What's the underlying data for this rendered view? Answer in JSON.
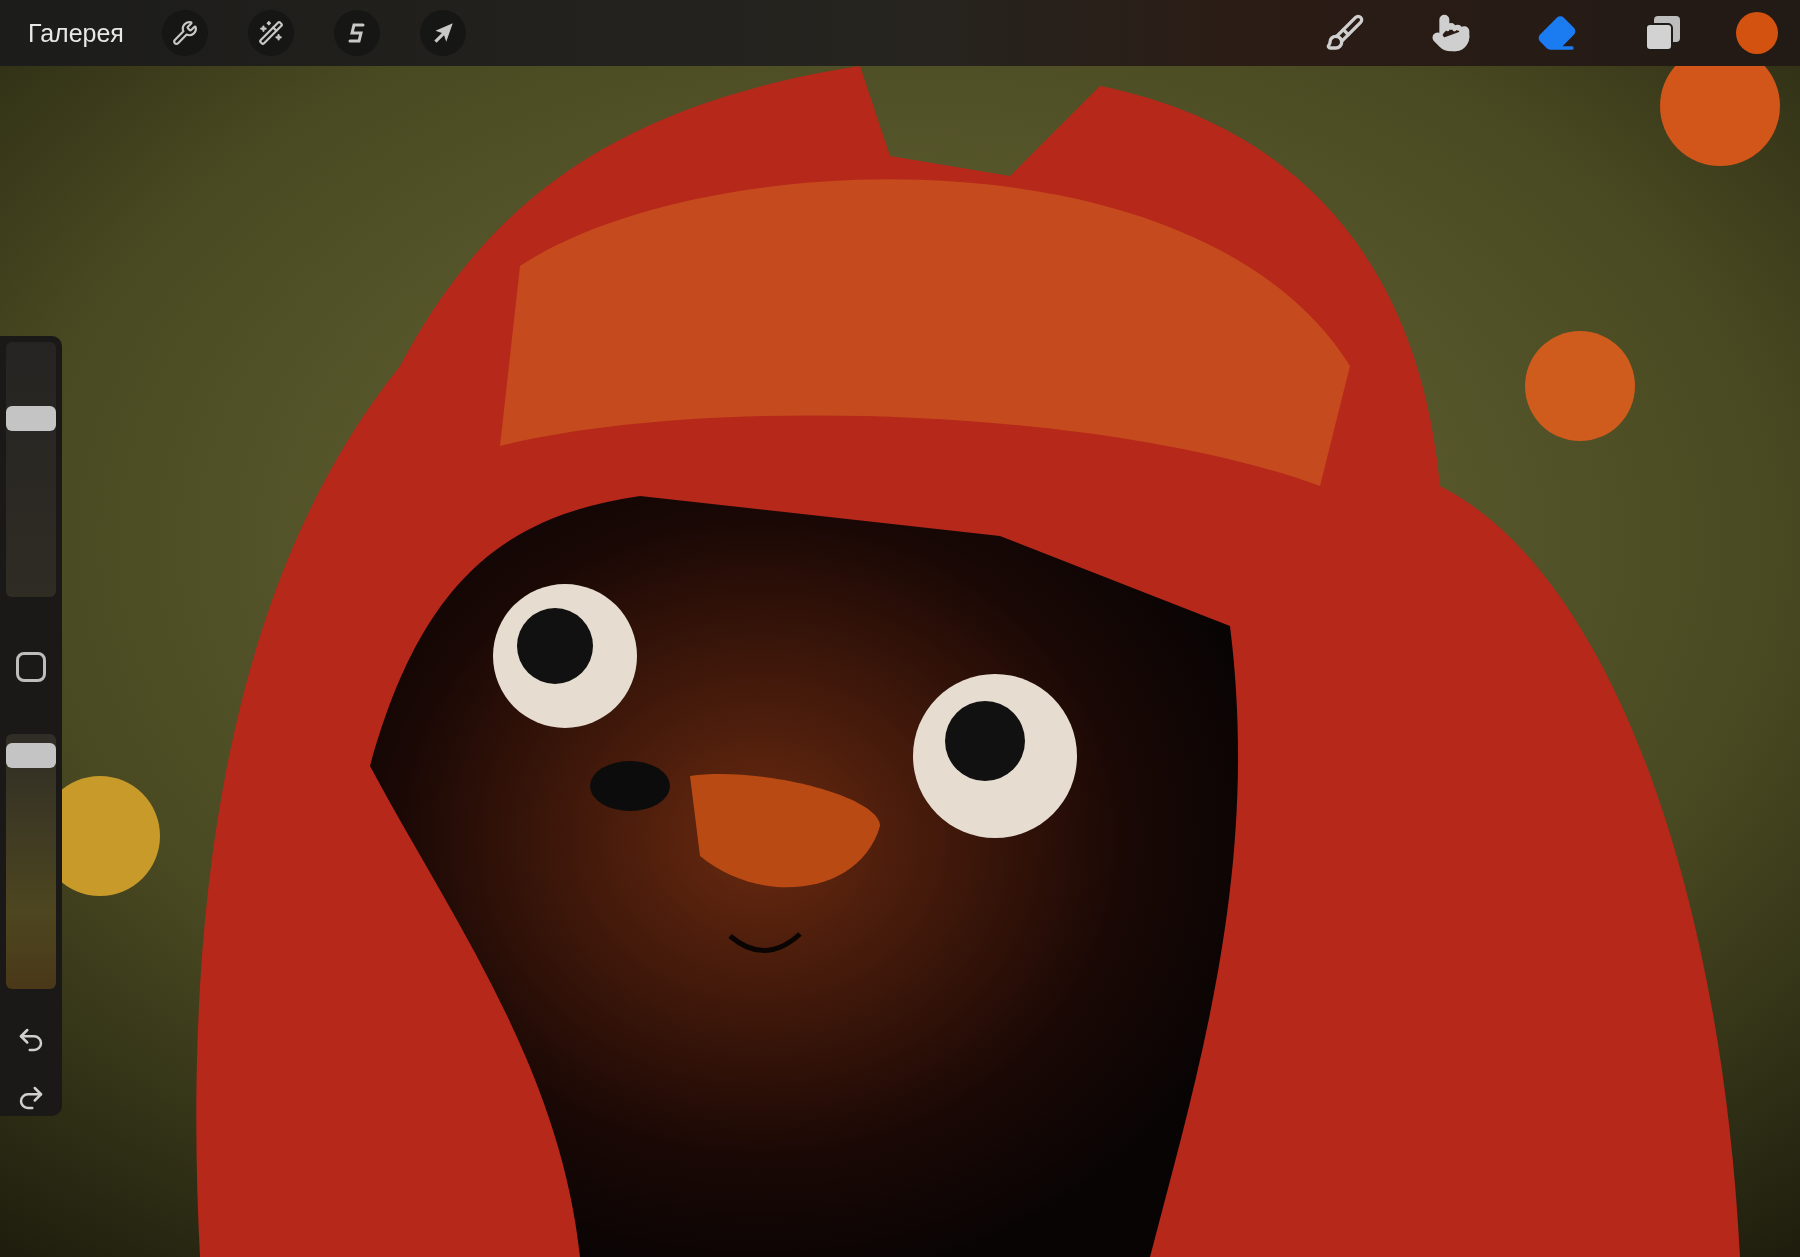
{
  "top_bar": {
    "gallery_label": "Галерея",
    "actions": [
      {
        "kind": "wrench"
      },
      {
        "kind": "wand"
      },
      {
        "kind": "selection"
      },
      {
        "kind": "transform"
      }
    ],
    "tools": [
      {
        "kind": "brush",
        "selected": false
      },
      {
        "kind": "smudge",
        "selected": false
      },
      {
        "kind": "eraser",
        "selected": true
      }
    ],
    "color_swatch": {
      "color": "#d4520f"
    }
  },
  "sidebar": {
    "size_slider": {
      "level": 0.72
    },
    "opacity_slider": {
      "level": 0.96
    }
  }
}
